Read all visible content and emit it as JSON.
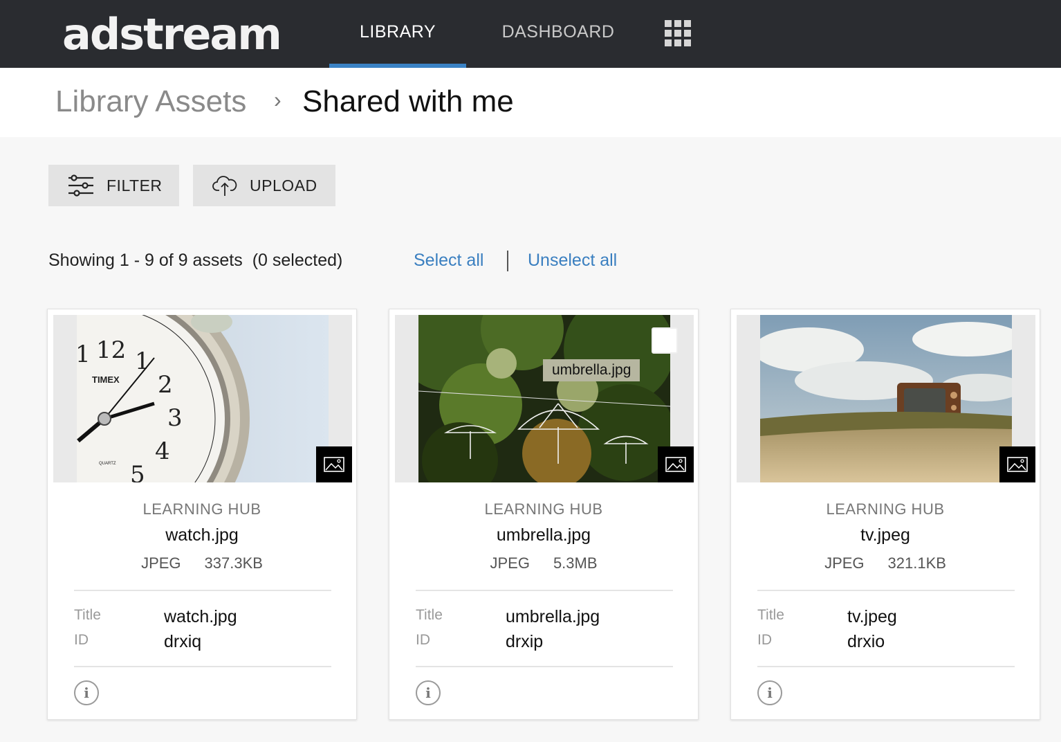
{
  "app": {
    "logo": "adstream",
    "nav": {
      "library": "LIBRARY",
      "dashboard": "DASHBOARD"
    },
    "accent": "#3a82c4"
  },
  "breadcrumb": {
    "parent": "Library Assets",
    "separator": "›",
    "current": "Shared with me"
  },
  "toolbar": {
    "filter_label": "FILTER",
    "upload_label": "UPLOAD"
  },
  "status": {
    "showing": "Showing 1 - 9 of 9 assets",
    "selected": "(0 selected)",
    "select_all": "Select all",
    "unselect_all": "Unselect all"
  },
  "cards": [
    {
      "source": "LEARNING HUB",
      "name": "watch.jpg",
      "type": "JPEG",
      "size": "337.3KB",
      "title_label": "Title",
      "title": "watch.jpg",
      "id_label": "ID",
      "id": "drxiq",
      "badge_icon": "image-icon"
    },
    {
      "source": "LEARNING HUB",
      "name": "umbrella.jpg",
      "type": "JPEG",
      "size": "5.3MB",
      "title_label": "Title",
      "title": "umbrella.jpg",
      "id_label": "ID",
      "id": "drxip",
      "tooltip": "umbrella.jpg",
      "badge_icon": "image-icon"
    },
    {
      "source": "LEARNING HUB",
      "name": "tv.jpeg",
      "type": "JPEG",
      "size": "321.1KB",
      "title_label": "Title",
      "title": "tv.jpeg",
      "id_label": "ID",
      "id": "drxio",
      "badge_icon": "image-icon"
    }
  ]
}
